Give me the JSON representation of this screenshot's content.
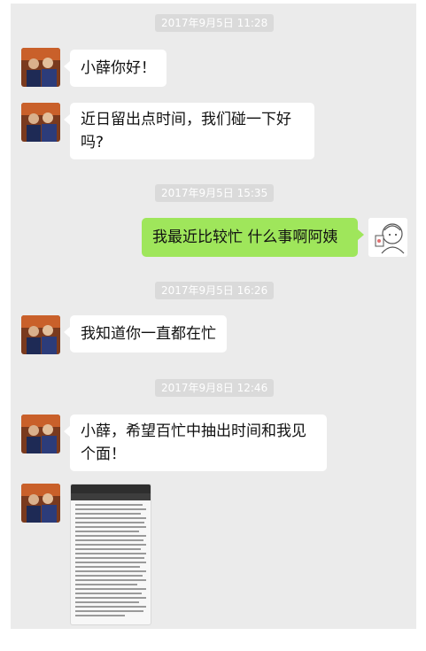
{
  "messages": [
    {
      "type": "time",
      "text": "2017年9月5日 11:28"
    },
    {
      "type": "text",
      "side": "left",
      "text": "小薛你好！"
    },
    {
      "type": "text",
      "side": "left",
      "lines": [
        "近日留出点时间，我们碰一下好",
        "吗?"
      ]
    },
    {
      "type": "time",
      "text": "2017年9月5日 15:35"
    },
    {
      "type": "text",
      "side": "right",
      "text": "我最近比较忙 什么事啊阿姨"
    },
    {
      "type": "time",
      "text": "2017年9月5日 16:26"
    },
    {
      "type": "text",
      "side": "left",
      "text": "我知道你一直都在忙"
    },
    {
      "type": "time",
      "text": "2017年9月8日 12:46"
    },
    {
      "type": "text",
      "side": "left",
      "lines": [
        "小薛，希望百忙中抽出时间和我见",
        "个面！"
      ]
    },
    {
      "type": "image",
      "side": "left",
      "description_icon": "document-screenshot-icon"
    }
  ],
  "colors": {
    "chat_bg": "#ebebeb",
    "bubble_left": "#ffffff",
    "bubble_right": "#9fe65b",
    "time_bg": "#dadada"
  },
  "icons": {
    "left_avatar": "avatar-photo-icon",
    "right_avatar": "cartoon-avatar-icon"
  }
}
